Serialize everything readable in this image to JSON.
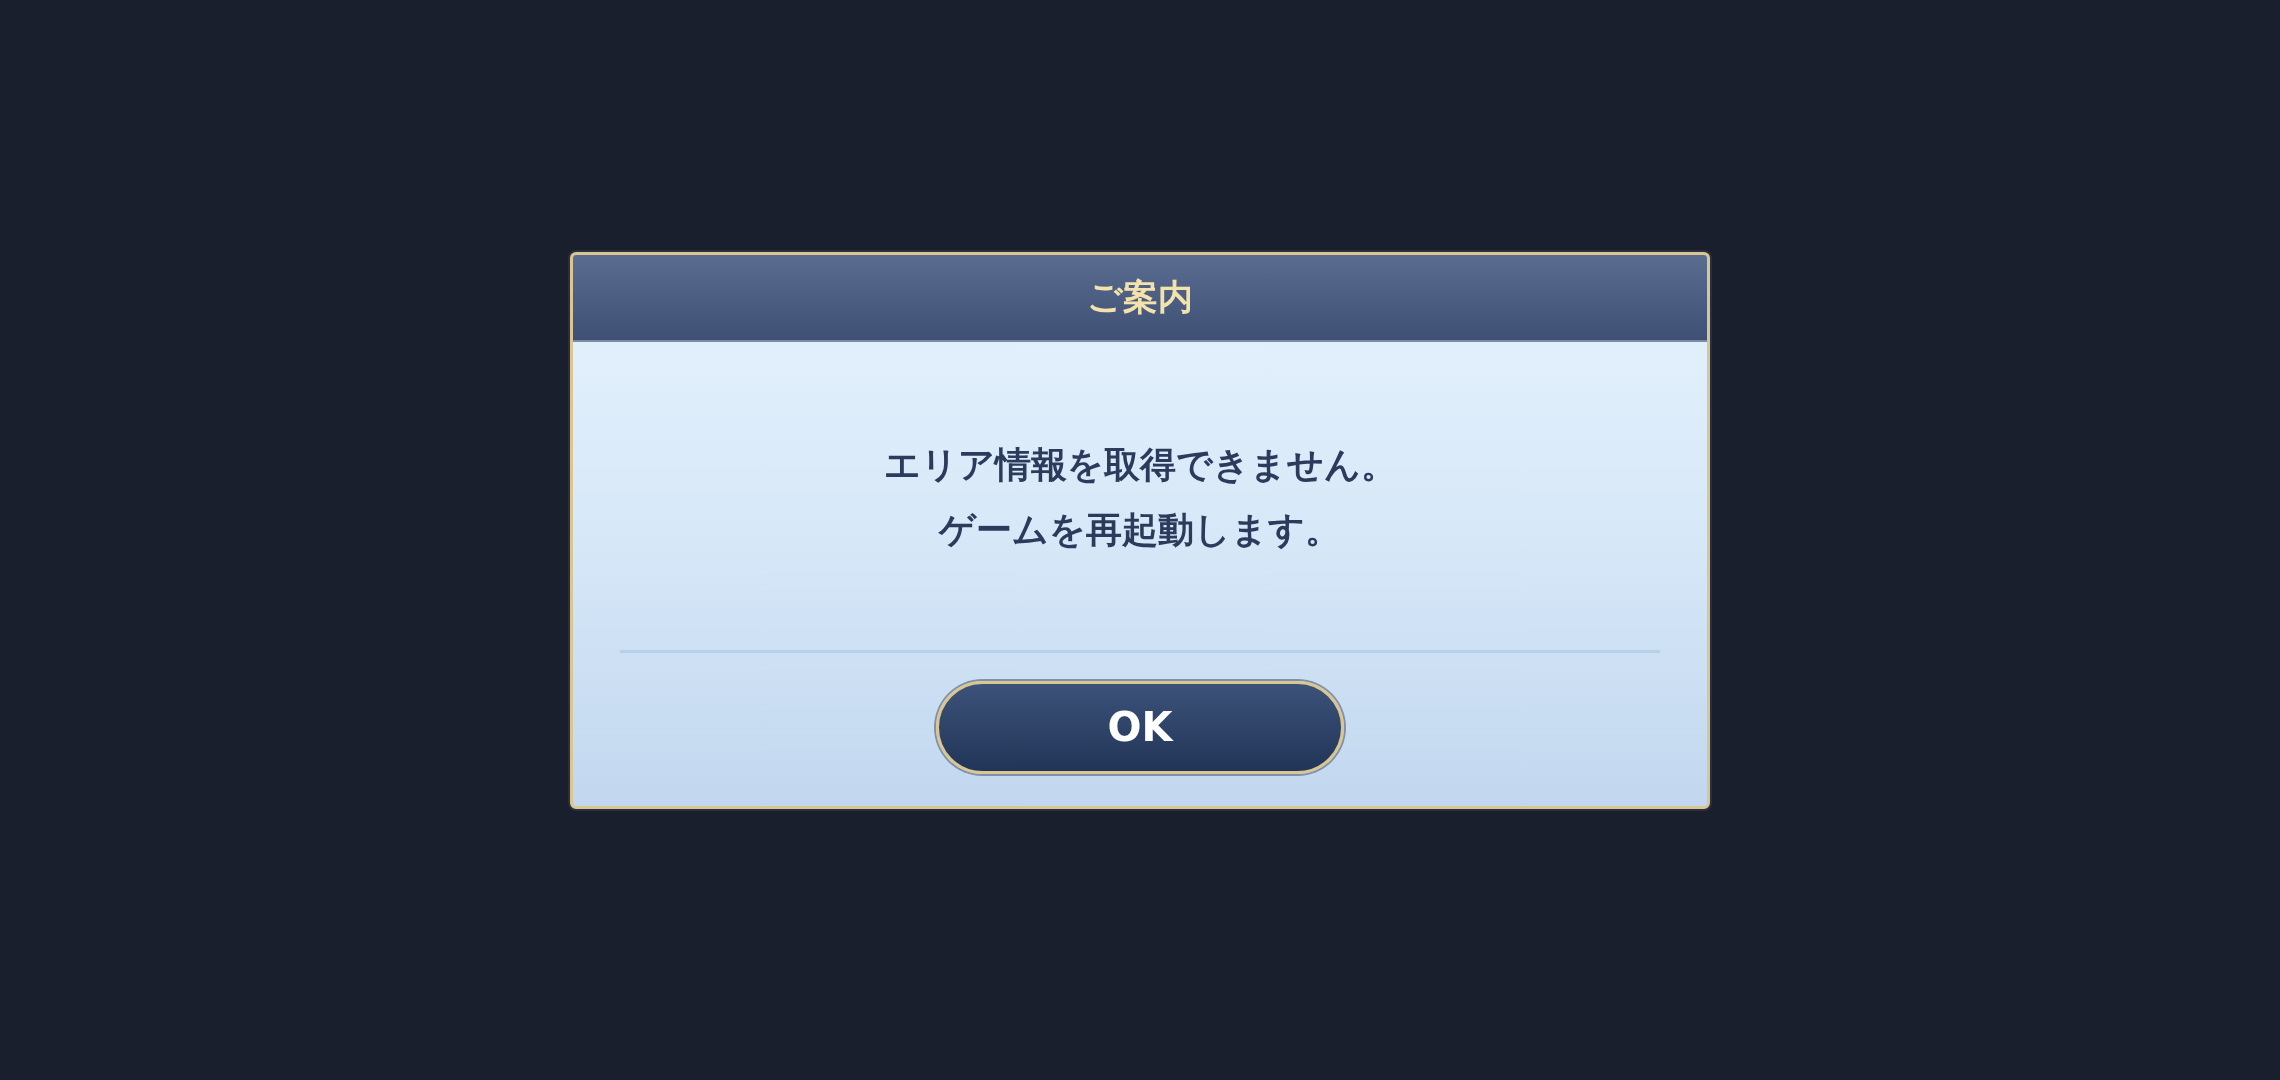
{
  "dialog": {
    "title": "ご案内",
    "message_lines": [
      "エリア情報を取得できません。",
      "ゲームを再起動します。"
    ],
    "button": "OK"
  }
}
